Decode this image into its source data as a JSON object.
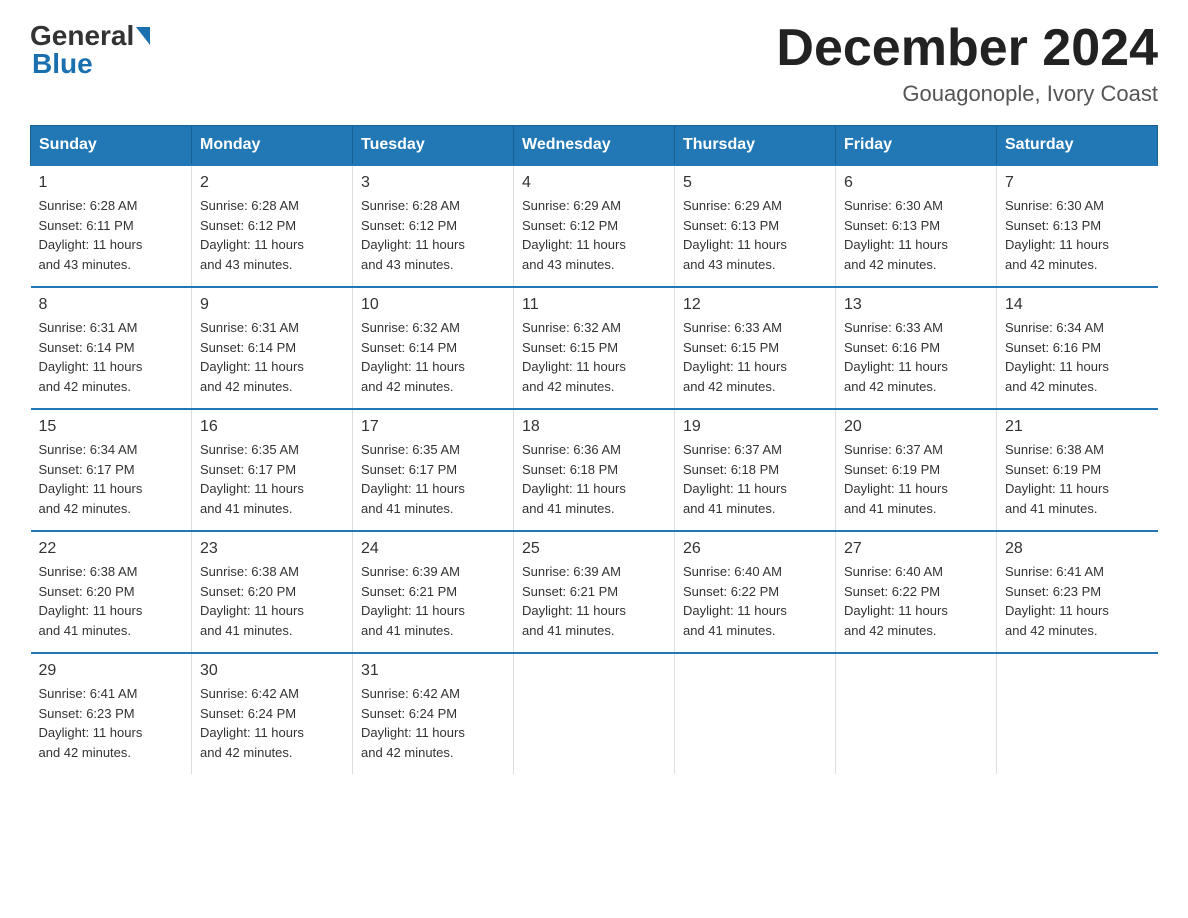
{
  "logo": {
    "general": "General",
    "blue": "Blue"
  },
  "title": "December 2024",
  "location": "Gouagonople, Ivory Coast",
  "days_of_week": [
    "Sunday",
    "Monday",
    "Tuesday",
    "Wednesday",
    "Thursday",
    "Friday",
    "Saturday"
  ],
  "weeks": [
    [
      {
        "day": "1",
        "info": "Sunrise: 6:28 AM\nSunset: 6:11 PM\nDaylight: 11 hours\nand 43 minutes."
      },
      {
        "day": "2",
        "info": "Sunrise: 6:28 AM\nSunset: 6:12 PM\nDaylight: 11 hours\nand 43 minutes."
      },
      {
        "day": "3",
        "info": "Sunrise: 6:28 AM\nSunset: 6:12 PM\nDaylight: 11 hours\nand 43 minutes."
      },
      {
        "day": "4",
        "info": "Sunrise: 6:29 AM\nSunset: 6:12 PM\nDaylight: 11 hours\nand 43 minutes."
      },
      {
        "day": "5",
        "info": "Sunrise: 6:29 AM\nSunset: 6:13 PM\nDaylight: 11 hours\nand 43 minutes."
      },
      {
        "day": "6",
        "info": "Sunrise: 6:30 AM\nSunset: 6:13 PM\nDaylight: 11 hours\nand 42 minutes."
      },
      {
        "day": "7",
        "info": "Sunrise: 6:30 AM\nSunset: 6:13 PM\nDaylight: 11 hours\nand 42 minutes."
      }
    ],
    [
      {
        "day": "8",
        "info": "Sunrise: 6:31 AM\nSunset: 6:14 PM\nDaylight: 11 hours\nand 42 minutes."
      },
      {
        "day": "9",
        "info": "Sunrise: 6:31 AM\nSunset: 6:14 PM\nDaylight: 11 hours\nand 42 minutes."
      },
      {
        "day": "10",
        "info": "Sunrise: 6:32 AM\nSunset: 6:14 PM\nDaylight: 11 hours\nand 42 minutes."
      },
      {
        "day": "11",
        "info": "Sunrise: 6:32 AM\nSunset: 6:15 PM\nDaylight: 11 hours\nand 42 minutes."
      },
      {
        "day": "12",
        "info": "Sunrise: 6:33 AM\nSunset: 6:15 PM\nDaylight: 11 hours\nand 42 minutes."
      },
      {
        "day": "13",
        "info": "Sunrise: 6:33 AM\nSunset: 6:16 PM\nDaylight: 11 hours\nand 42 minutes."
      },
      {
        "day": "14",
        "info": "Sunrise: 6:34 AM\nSunset: 6:16 PM\nDaylight: 11 hours\nand 42 minutes."
      }
    ],
    [
      {
        "day": "15",
        "info": "Sunrise: 6:34 AM\nSunset: 6:17 PM\nDaylight: 11 hours\nand 42 minutes."
      },
      {
        "day": "16",
        "info": "Sunrise: 6:35 AM\nSunset: 6:17 PM\nDaylight: 11 hours\nand 41 minutes."
      },
      {
        "day": "17",
        "info": "Sunrise: 6:35 AM\nSunset: 6:17 PM\nDaylight: 11 hours\nand 41 minutes."
      },
      {
        "day": "18",
        "info": "Sunrise: 6:36 AM\nSunset: 6:18 PM\nDaylight: 11 hours\nand 41 minutes."
      },
      {
        "day": "19",
        "info": "Sunrise: 6:37 AM\nSunset: 6:18 PM\nDaylight: 11 hours\nand 41 minutes."
      },
      {
        "day": "20",
        "info": "Sunrise: 6:37 AM\nSunset: 6:19 PM\nDaylight: 11 hours\nand 41 minutes."
      },
      {
        "day": "21",
        "info": "Sunrise: 6:38 AM\nSunset: 6:19 PM\nDaylight: 11 hours\nand 41 minutes."
      }
    ],
    [
      {
        "day": "22",
        "info": "Sunrise: 6:38 AM\nSunset: 6:20 PM\nDaylight: 11 hours\nand 41 minutes."
      },
      {
        "day": "23",
        "info": "Sunrise: 6:38 AM\nSunset: 6:20 PM\nDaylight: 11 hours\nand 41 minutes."
      },
      {
        "day": "24",
        "info": "Sunrise: 6:39 AM\nSunset: 6:21 PM\nDaylight: 11 hours\nand 41 minutes."
      },
      {
        "day": "25",
        "info": "Sunrise: 6:39 AM\nSunset: 6:21 PM\nDaylight: 11 hours\nand 41 minutes."
      },
      {
        "day": "26",
        "info": "Sunrise: 6:40 AM\nSunset: 6:22 PM\nDaylight: 11 hours\nand 41 minutes."
      },
      {
        "day": "27",
        "info": "Sunrise: 6:40 AM\nSunset: 6:22 PM\nDaylight: 11 hours\nand 42 minutes."
      },
      {
        "day": "28",
        "info": "Sunrise: 6:41 AM\nSunset: 6:23 PM\nDaylight: 11 hours\nand 42 minutes."
      }
    ],
    [
      {
        "day": "29",
        "info": "Sunrise: 6:41 AM\nSunset: 6:23 PM\nDaylight: 11 hours\nand 42 minutes."
      },
      {
        "day": "30",
        "info": "Sunrise: 6:42 AM\nSunset: 6:24 PM\nDaylight: 11 hours\nand 42 minutes."
      },
      {
        "day": "31",
        "info": "Sunrise: 6:42 AM\nSunset: 6:24 PM\nDaylight: 11 hours\nand 42 minutes."
      },
      null,
      null,
      null,
      null
    ]
  ]
}
